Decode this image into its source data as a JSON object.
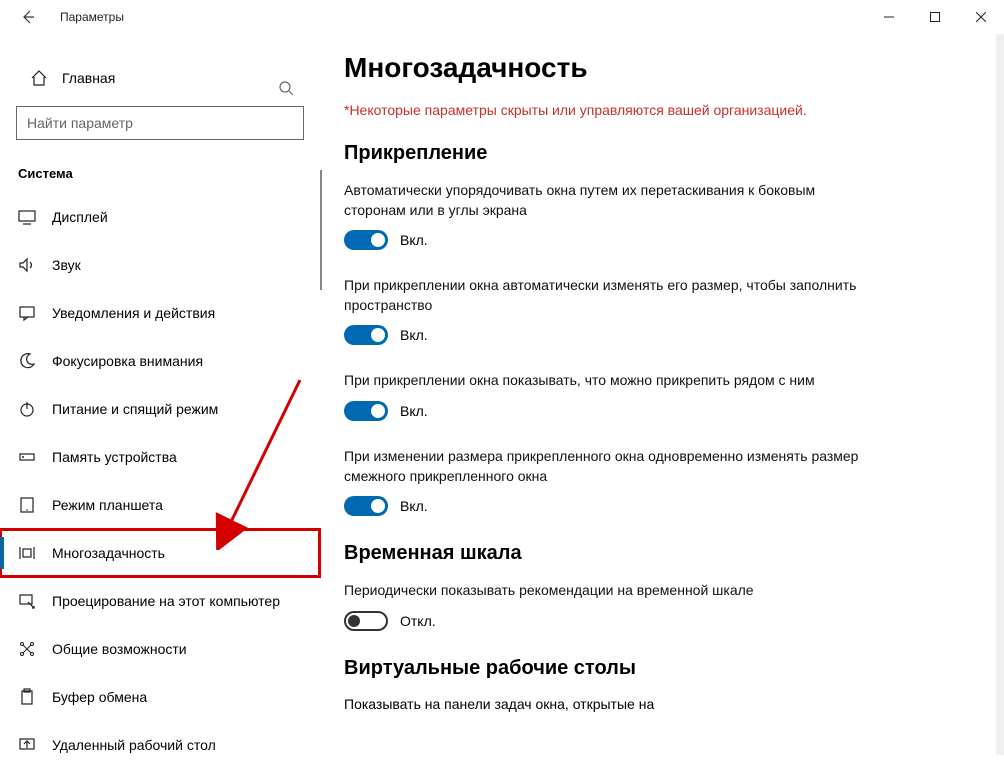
{
  "titlebar": {
    "title": "Параметры"
  },
  "sidebar": {
    "home": "Главная",
    "search_placeholder": "Найти параметр",
    "section": "Система",
    "items": [
      {
        "label": "Дисплей"
      },
      {
        "label": "Звук"
      },
      {
        "label": "Уведомления и действия"
      },
      {
        "label": "Фокусировка внимания"
      },
      {
        "label": "Питание и спящий режим"
      },
      {
        "label": "Память устройства"
      },
      {
        "label": "Режим планшета"
      },
      {
        "label": "Многозадачность"
      },
      {
        "label": "Проецирование на этот компьютер"
      },
      {
        "label": "Общие возможности"
      },
      {
        "label": "Буфер обмена"
      },
      {
        "label": "Удаленный рабочий стол"
      }
    ]
  },
  "main": {
    "page_title": "Многозадачность",
    "org_note": "*Некоторые параметры скрыты или управляются вашей организацией.",
    "snap_heading": "Прикрепление",
    "snap1_desc": "Автоматически упорядочивать окна путем их перетаскивания к боковым сторонам или в углы экрана",
    "snap2_desc": "При прикреплении окна автоматически изменять его размер, чтобы заполнить пространство",
    "snap3_desc": "При прикреплении окна показывать, что можно прикрепить рядом с ним",
    "snap4_desc": "При изменении размера прикрепленного окна одновременно изменять размер смежного прикрепленного окна",
    "timeline_heading": "Временная шкала",
    "timeline_desc": "Периодически показывать рекомендации на временной шкале",
    "vd_heading": "Виртуальные рабочие столы",
    "vd_desc": "Показывать на панели задач окна, открытые на",
    "on_label": "Вкл.",
    "off_label": "Откл."
  },
  "toggles": {
    "snap1": true,
    "snap2": true,
    "snap3": true,
    "snap4": true,
    "timeline": false
  }
}
